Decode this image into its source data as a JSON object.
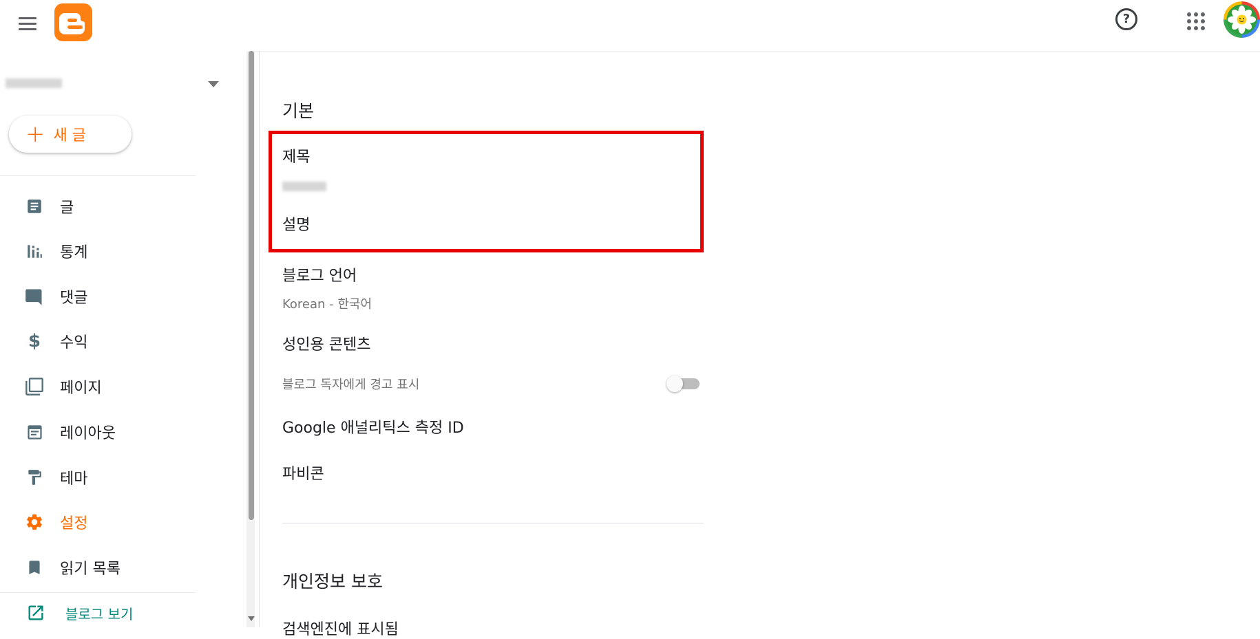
{
  "header": {
    "menu_icon": "hamburger-menu-icon",
    "logo_icon": "blogger-logo-icon",
    "help_icon": "help-circle-icon",
    "apps_icon": "apps-grid-icon",
    "avatar_icon": "flower-avatar-icon",
    "help_label": "?"
  },
  "sidebar": {
    "blog_select_icon": "dropdown-caret-icon",
    "new_post": {
      "plus": "+",
      "label": "새 글"
    },
    "items": [
      {
        "label": "글",
        "icon": "posts-icon"
      },
      {
        "label": "통계",
        "icon": "stats-icon"
      },
      {
        "label": "댓글",
        "icon": "comment-icon"
      },
      {
        "label": "수익",
        "icon": "dollar-icon"
      },
      {
        "label": "페이지",
        "icon": "pages-icon"
      },
      {
        "label": "레이아웃",
        "icon": "layout-icon"
      },
      {
        "label": "테마",
        "icon": "theme-paint-roller-icon"
      },
      {
        "label": "설정",
        "icon": "gear-icon",
        "active": true
      },
      {
        "label": "읽기 목록",
        "icon": "bookmark-icon"
      }
    ],
    "view_blog": {
      "label": "블로그 보기",
      "icon": "open-in-new-icon"
    },
    "colors": {
      "accent": "#ff6d00",
      "icon": "#546e7a",
      "view": "#00897b"
    }
  },
  "main": {
    "sections": {
      "basic": "기본",
      "privacy": "개인정보 보호",
      "privacy_partial": "검색엔진에 표시됨"
    },
    "fields": {
      "title_label": "제목",
      "description_label": "설명",
      "language_label": "블로그 언어",
      "language_value": "Korean - 한국어",
      "adult_label": "성인용 콘텐츠",
      "adult_desc": "블로그 독자에게 경고 표시",
      "analytics_label": "Google 애널리틱스 측정 ID",
      "favicon_label": "파비콘"
    },
    "adult_toggle_on": false,
    "highlight_color": "#e60000"
  }
}
